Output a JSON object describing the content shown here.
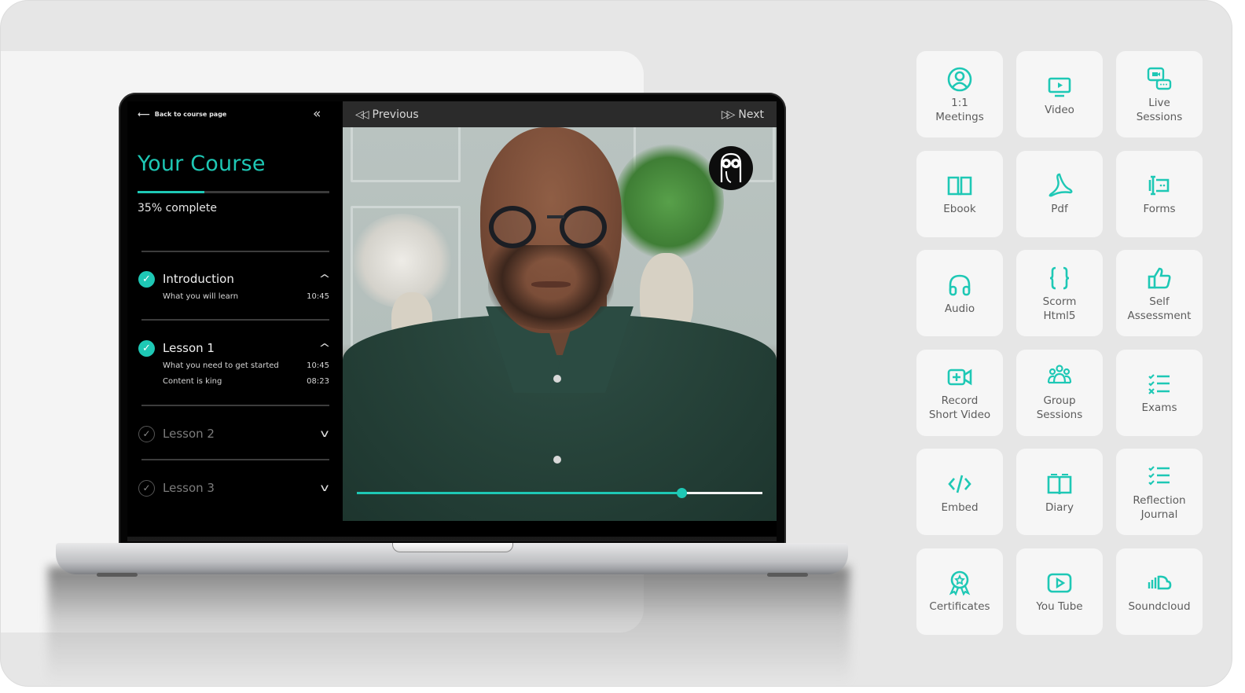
{
  "colors": {
    "accent": "#1ec8b5",
    "sidebar_bg": "#000000",
    "player_bar_bg": "#2b2b2b",
    "tile_bg": "#f6f6f6",
    "tile_text": "#5c5c5c",
    "page_bg": "#e6e6e6"
  },
  "sidebar": {
    "back_link": "Back to course page",
    "back_icon": "arrow-left-icon",
    "collapse_icon": "double-chevron-left-icon",
    "course_title": "Your Course",
    "progress_percent": 35,
    "progress_text": "35% complete",
    "modules": [
      {
        "title": "Introduction",
        "completed": true,
        "expanded": true,
        "items": [
          {
            "title": "What you will learn",
            "duration": "10:45"
          }
        ]
      },
      {
        "title": "Lesson 1",
        "completed": true,
        "expanded": true,
        "items": [
          {
            "title": "What you need to get started",
            "duration": "10:45"
          },
          {
            "title": "Content is king",
            "duration": "08:23"
          }
        ]
      },
      {
        "title": "Lesson 2",
        "completed": false,
        "expanded": false,
        "items": []
      },
      {
        "title": "Lesson 3",
        "completed": false,
        "expanded": false,
        "items": []
      }
    ]
  },
  "player": {
    "previous_label": "Previous",
    "next_label": "Next",
    "previous_icon": "rewind-icon",
    "next_icon": "fast-forward-icon",
    "logo_icon": "owl-logo-icon",
    "playback_progress": 0.8
  },
  "features": [
    {
      "label": "1:1\nMeetings",
      "icon": "user-circle-icon"
    },
    {
      "label": "Video",
      "icon": "monitor-play-icon"
    },
    {
      "label": "Live\nSessions",
      "icon": "video-chat-icon"
    },
    {
      "label": "Ebook",
      "icon": "open-book-icon"
    },
    {
      "label": "Pdf",
      "icon": "pdf-icon"
    },
    {
      "label": "Forms",
      "icon": "form-field-icon"
    },
    {
      "label": "Audio",
      "icon": "headphones-icon"
    },
    {
      "label": "Scorm\nHtml5",
      "icon": "curly-braces-icon"
    },
    {
      "label": "Self\nAssessment",
      "icon": "thumbs-up-icon"
    },
    {
      "label": "Record\nShort Video",
      "icon": "video-add-icon"
    },
    {
      "label": "Group\nSessions",
      "icon": "group-icon"
    },
    {
      "label": "Exams",
      "icon": "checklist-x-icon"
    },
    {
      "label": "Embed",
      "icon": "code-icon"
    },
    {
      "label": "Diary",
      "icon": "diary-book-icon"
    },
    {
      "label": "Reflection\nJournal",
      "icon": "checklist-icon"
    },
    {
      "label": "Certificates",
      "icon": "award-icon"
    },
    {
      "label": "You Tube",
      "icon": "youtube-icon"
    },
    {
      "label": "Soundcloud",
      "icon": "soundcloud-icon"
    }
  ]
}
